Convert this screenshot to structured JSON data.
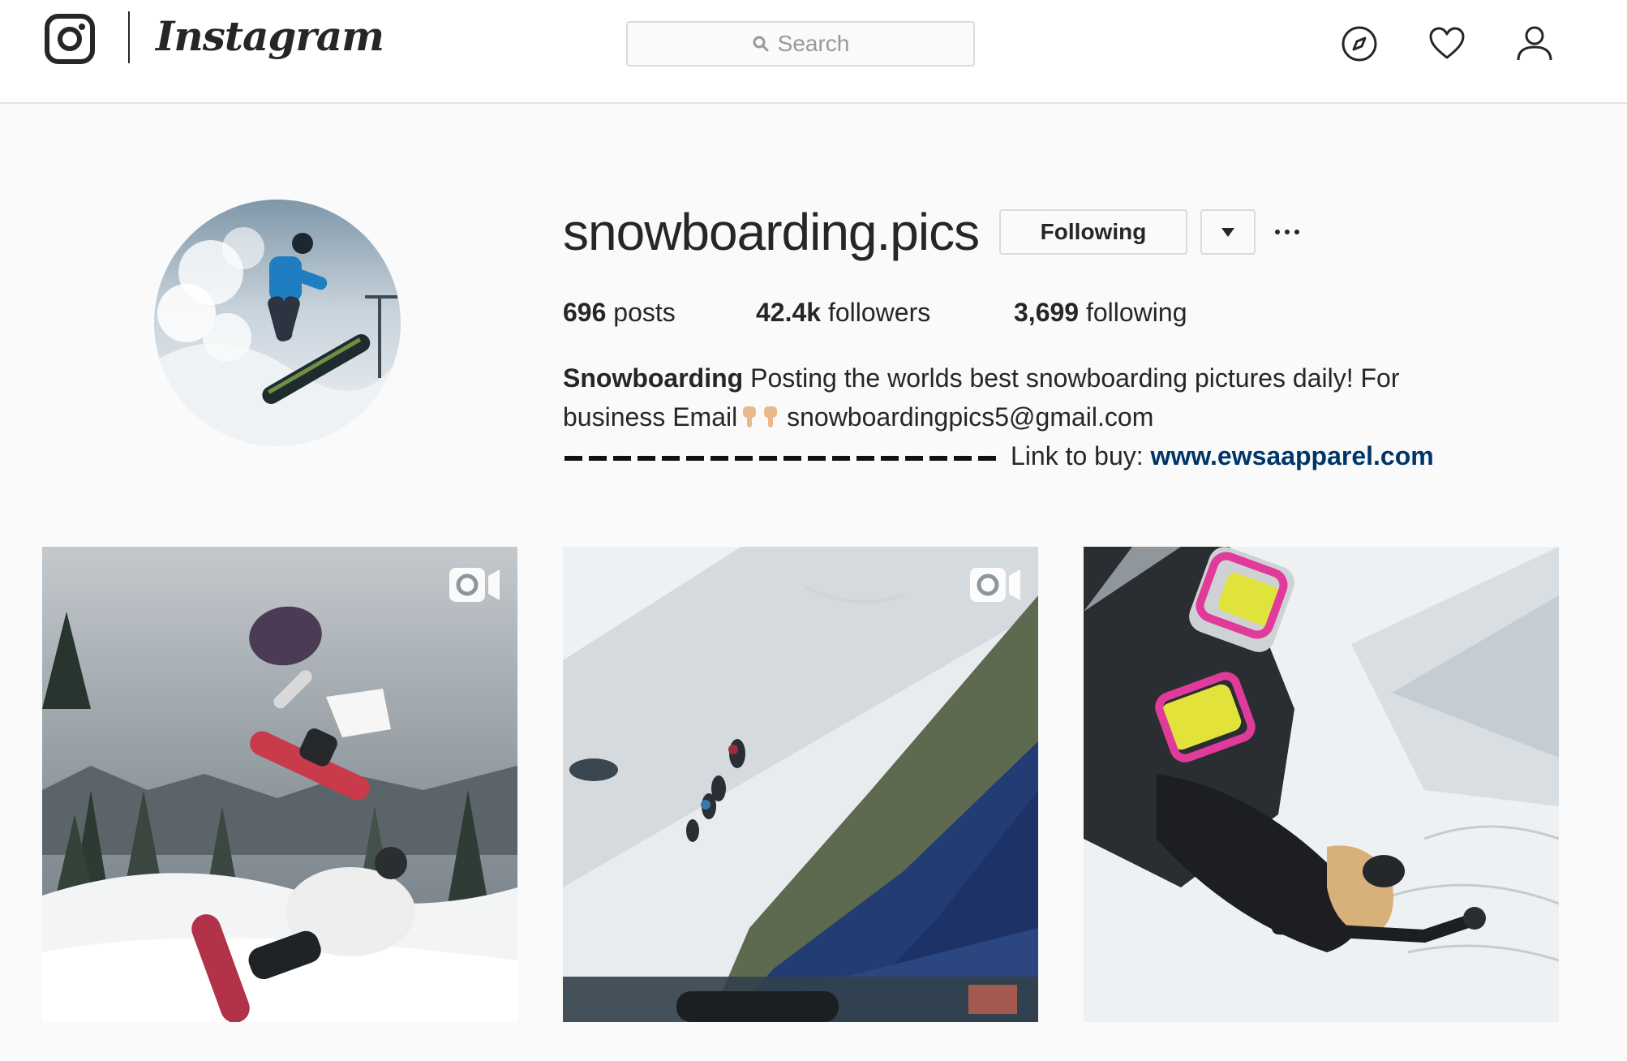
{
  "header": {
    "logo_text": "Instagram",
    "search_placeholder": "Search",
    "icons": [
      "instagram-glyph-icon",
      "search-icon",
      "compass-icon",
      "heart-icon",
      "user-icon"
    ]
  },
  "profile": {
    "username": "snowboarding.pics",
    "following_button_label": "Following",
    "stats": {
      "posts_count": "696",
      "posts_label": "posts",
      "followers_count": "42.4k",
      "followers_label": "followers",
      "following_count": "3,699",
      "following_label": "following"
    },
    "bio": {
      "full_name": "Snowboarding",
      "line1_text": "Posting the worlds best snowboarding pictures daily! For",
      "line2_prefix": "business Email",
      "email": "snowboardingpics5@gmail.com",
      "line3_label": "Link to buy:",
      "link": "www.ewsaapparel.com"
    }
  },
  "grid": {
    "posts": [
      {
        "is_video": true
      },
      {
        "is_video": true
      },
      {
        "is_video": false
      }
    ]
  },
  "colors": {
    "background": "#fafafa",
    "text": "#262626",
    "link": "#003569",
    "border": "#dbdbdb"
  }
}
